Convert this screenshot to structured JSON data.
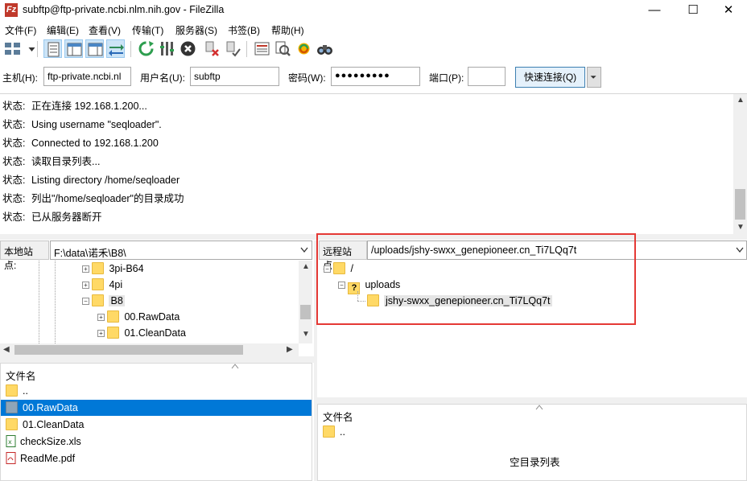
{
  "window": {
    "title": "subftp@ftp-private.ncbi.nlm.nih.gov - FileZilla",
    "app_icon_letter": "Fz",
    "minimize": "—",
    "maximize": "☐",
    "close": "✕"
  },
  "menu": [
    "文件(F)",
    "编辑(E)",
    "查看(V)",
    "传输(T)",
    "服务器(S)",
    "书签(B)",
    "帮助(H)"
  ],
  "toolbar": {
    "icons": [
      "site-manager-icon",
      "dropdown-arrow-icon",
      "toggle-log-icon",
      "toggle-local-tree-icon",
      "toggle-remote-tree-icon",
      "toggle-queue-icon",
      "refresh-icon",
      "process-queue-icon",
      "cancel-icon",
      "disconnect-icon",
      "reconnect-icon",
      "filter-icon",
      "compare-icon",
      "sync-browse-icon",
      "search-icon"
    ]
  },
  "quickconnect": {
    "host_label": "主机(H):",
    "host_value": "ftp-private.ncbi.nl",
    "user_label": "用户名(U):",
    "user_value": "subftp",
    "pass_label": "密码(W):",
    "pass_value": "●●●●●●●●●",
    "port_label": "端口(P):",
    "port_value": "",
    "connect_label": "快速连接(Q)"
  },
  "log": [
    {
      "k": "状态:",
      "v": "正在连接 192.168.1.200..."
    },
    {
      "k": "状态:",
      "v": "Using username \"seqloader\"."
    },
    {
      "k": "状态:",
      "v": "Connected to 192.168.1.200"
    },
    {
      "k": "状态:",
      "v": "读取目录列表..."
    },
    {
      "k": "状态:",
      "v": "Listing directory /home/seqloader"
    },
    {
      "k": "状态:",
      "v": "列出\"/home/seqloader\"的目录成功"
    },
    {
      "k": "状态:",
      "v": "已从服务器断开"
    }
  ],
  "local": {
    "label": "本地站点:",
    "path": "F:\\data\\诺禾\\B8\\",
    "tree": [
      "3pi-B64",
      "4pi",
      "B8",
      "00.RawData",
      "01.CleanData"
    ],
    "column_filename": "文件名",
    "files": [
      "..",
      "00.RawData",
      "01.CleanData",
      "checkSize.xls",
      "ReadMe.pdf"
    ]
  },
  "remote": {
    "label": "远程站点:",
    "path": "/uploads/jshy-swxx_genepioneer.cn_Ti7LQq7t",
    "tree": [
      "/",
      "uploads",
      "jshy-swxx_genepioneer.cn_Ti7LQq7t"
    ],
    "column_filename": "文件名",
    "files": [
      ".."
    ],
    "empty_text": "空目录列表"
  },
  "colors": {
    "highlight_red": "#e53935",
    "selection_blue": "#0078d7",
    "folder_yellow": "#ffd966"
  }
}
